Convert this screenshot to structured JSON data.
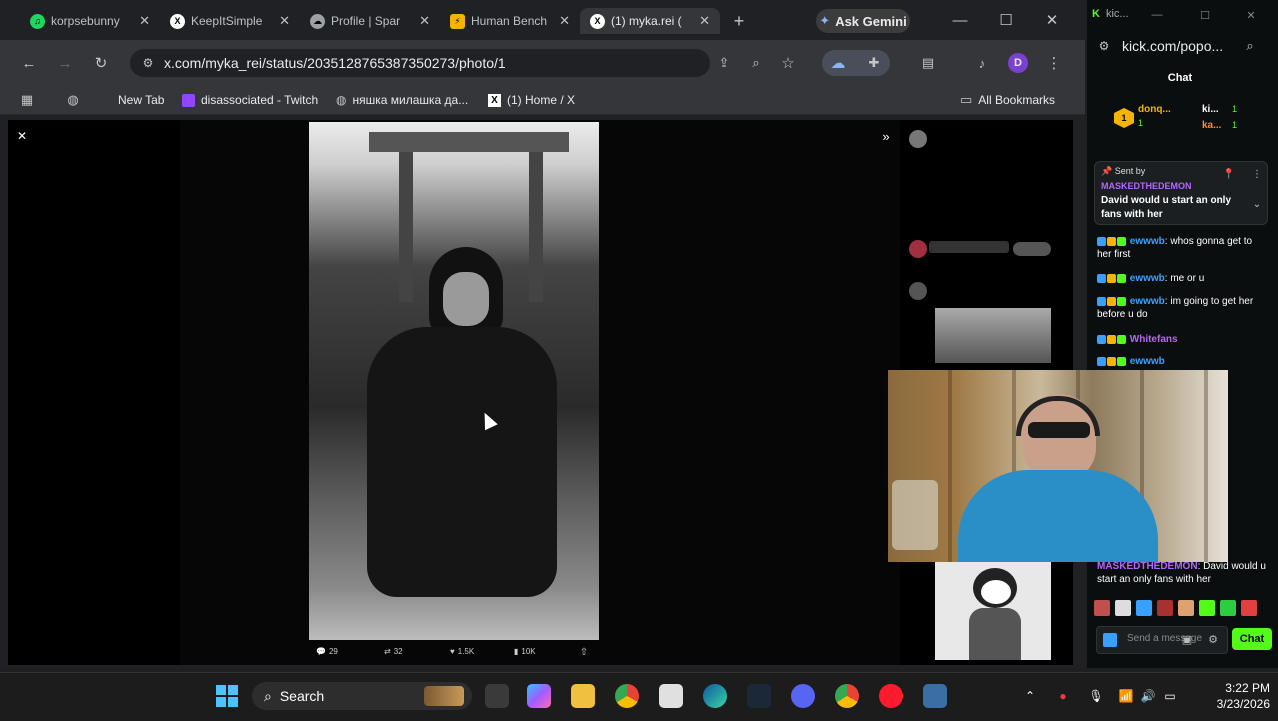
{
  "tabs": [
    {
      "title": "korpsebunny",
      "color": "#1ed760",
      "glyph": "♫"
    },
    {
      "title": "KeepItSimple",
      "color": "#ffffff",
      "glyph": "X"
    },
    {
      "title": "Profile | Spar",
      "color": "#9aa0a6",
      "glyph": "☁"
    },
    {
      "title": "Human Bench",
      "color": "#f4b400",
      "glyph": "⚡"
    },
    {
      "title": "(1) myka.rei (",
      "color": "#ffffff",
      "glyph": "X"
    }
  ],
  "ask_gemini": "Ask Gemini",
  "address": "x.com/myka_rei/status/2035128765387350273/photo/1",
  "profile_initial": "D",
  "bookmarks": [
    {
      "label": "New Tab"
    },
    {
      "label": "disassociated - Twitch"
    },
    {
      "label": "няшка милашка да..."
    },
    {
      "label": "(1) Home / X"
    }
  ],
  "all_bookmarks": "All Bookmarks",
  "photo_actions": [
    "29",
    "32",
    "1.5K",
    "10K"
  ],
  "kick": {
    "url": "kick.com/popo...",
    "chat_title": "Chat",
    "tab_label": "kic...",
    "leaderboard": [
      "donq...",
      "ki...",
      "ka..."
    ],
    "leader_counts": [
      "1",
      "1",
      "1"
    ],
    "pinned_by_label": "Sent by",
    "pinned_user": "MASKEDTHEDEMON",
    "pinned_msg": "David would u start an only fans with her",
    "messages": [
      {
        "user": "ewwwb",
        "text": ": whos gonna get to her first",
        "color": "#3aa0ff"
      },
      {
        "user": "ewwwb",
        "text": ": me or u",
        "color": "#3aa0ff"
      },
      {
        "user": "ewwwb",
        "text": ": im going to get her before u do",
        "color": "#3aa0ff"
      },
      {
        "user": "Whitefans",
        "text": "",
        "color": "#b366ff"
      },
      {
        "user": "ewwwb",
        "text": "",
        "color": "#3aa0ff"
      }
    ],
    "last_user": "MASKEDTHEDEMON",
    "last_msg": ": David would u start an only fans with her",
    "send_placeholder": "Send a message",
    "chat_button": "Chat"
  },
  "taskbar": {
    "search": "Search",
    "time": "3:22 PM",
    "date": "3/23/2026"
  }
}
